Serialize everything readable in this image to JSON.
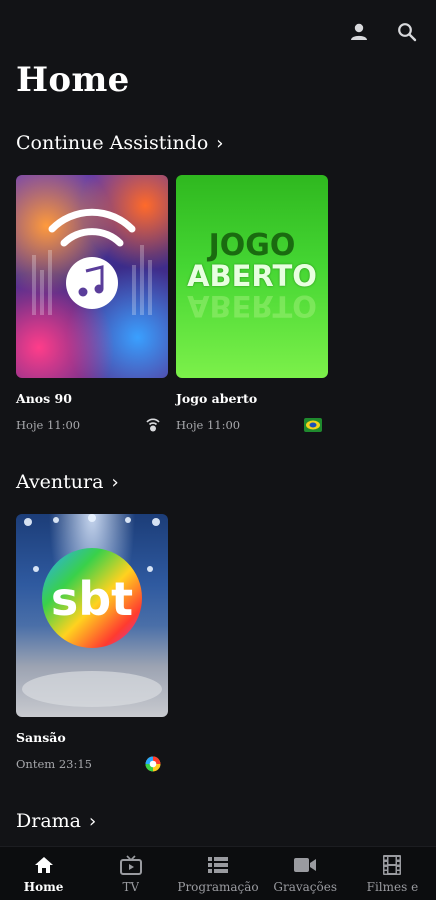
{
  "page": {
    "title": "Home"
  },
  "sections": [
    {
      "title": "Continue Assistindo"
    },
    {
      "title": "Aventura"
    },
    {
      "title": "Drama"
    }
  ],
  "continue_watching": [
    {
      "name": "Anos 90",
      "time": "Hoje 11:00",
      "channel_icon": "music-channel-icon"
    },
    {
      "name": "Jogo aberto",
      "time": "Hoje 11:00",
      "channel_icon": "band-channel-icon"
    }
  ],
  "adventure": [
    {
      "name": "Sansão",
      "time": "Ontem 23:15",
      "channel_icon": "sbt-channel-icon"
    }
  ],
  "thumb_text": {
    "jogo_line1": "JOGO",
    "jogo_line2": "ABERTO",
    "sbt_logo": "sbt"
  },
  "nav": [
    {
      "label": "Home",
      "icon": "home-icon",
      "active": true
    },
    {
      "label": "TV",
      "icon": "tv-icon",
      "active": false
    },
    {
      "label": "Programação",
      "icon": "list-icon",
      "active": false
    },
    {
      "label": "Gravações",
      "icon": "video-camera-icon",
      "active": false
    },
    {
      "label": "Filmes e",
      "icon": "film-icon",
      "active": false
    }
  ],
  "colors": {
    "background": "#121316",
    "accent_green": "#3fd62a",
    "muted_text": "#a7a8ac"
  }
}
